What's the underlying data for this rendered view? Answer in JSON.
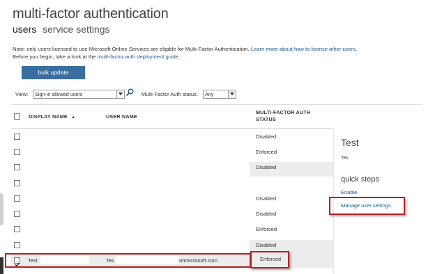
{
  "page": {
    "title": "multi-factor authentication",
    "tabs": {
      "users": "users",
      "service_settings": "service settings"
    }
  },
  "note": {
    "line1_prefix": "Note: only users licensed to use Microsoft Online Services are eligible for Multi-Factor Authentication.",
    "line1_link": "Learn more about how to license other users.",
    "line2_prefix": "Before you begin, take a look at the",
    "line2_link": "multi-factor auth deployment guide."
  },
  "toolbar": {
    "bulk_update": "bulk update",
    "view_label": "View:",
    "view_value": "Sign-in allowed users",
    "mfa_status_label": "Multi-Factor Auth status:",
    "mfa_status_value": "Any",
    "search_icon": "search-icon"
  },
  "table": {
    "columns": {
      "display_name": "DISPLAY NAME",
      "user_name": "USER NAME",
      "mfa_status_line1": "MULTI-FACTOR AUTH",
      "mfa_status_line2": "STATUS"
    },
    "sort_indicator": "▲",
    "rows": [
      {
        "display_name": "",
        "user_name": "",
        "status": "Disabled",
        "checked": false
      },
      {
        "display_name": "",
        "user_name": "",
        "status": "Enforced",
        "checked": false
      },
      {
        "display_name": "",
        "user_name": "",
        "status": "Disabled",
        "checked": false
      },
      {
        "display_name": "",
        "user_name": "",
        "status": "",
        "checked": false
      },
      {
        "display_name": "",
        "user_name": "",
        "status": "Disabled",
        "checked": false
      },
      {
        "display_name": "",
        "user_name": "",
        "status": "Disabled",
        "checked": false
      },
      {
        "display_name": "",
        "user_name": "",
        "status": "Enforced",
        "checked": false
      },
      {
        "display_name": "",
        "user_name": "",
        "status": "Disabled",
        "checked": false
      },
      {
        "display_name": "Test",
        "user_name": "Tes",
        "user_name_suffix": "onmicrosoft.com",
        "status": "Enforced",
        "checked": true
      }
    ]
  },
  "side_panel": {
    "title": "Test",
    "user": "Tes",
    "quick_steps": "quick steps",
    "enable": "Enable",
    "manage_user_settings": "Manage user settings"
  },
  "colors": {
    "accent": "#3a6ea0",
    "link": "#1a5a9a",
    "highlight": "#b22222"
  }
}
